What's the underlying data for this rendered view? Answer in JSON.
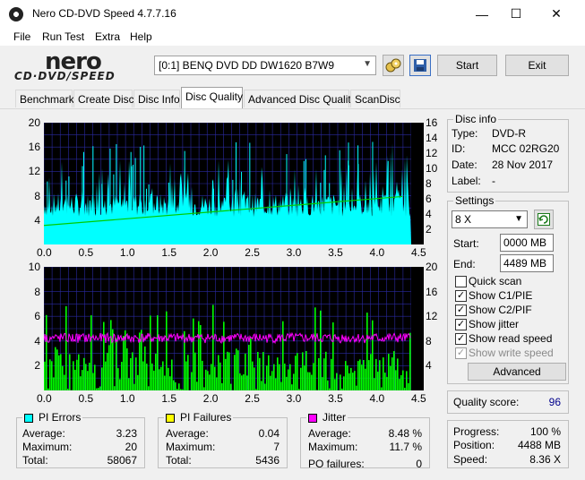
{
  "window": {
    "title": "Nero CD-DVD Speed 4.7.7.16",
    "minimize": "—",
    "maximize": "☐",
    "close": "✕"
  },
  "menu": [
    "File",
    "Run Test",
    "Extra",
    "Help"
  ],
  "logo": {
    "line1": "nero",
    "line2": "CD·DVD/SPEED"
  },
  "toolbar": {
    "drive": "[0:1]  BENQ DVD DD DW1620 B7W9",
    "start": "Start",
    "exit": "Exit",
    "icons": [
      "eject-swap-icon",
      "save-icon"
    ]
  },
  "tabs": [
    "Benchmark",
    "Create Disc",
    "Disc Info",
    "Disc Quality",
    "Advanced Disc Quality",
    "ScanDisc"
  ],
  "active_tab": "Disc Quality",
  "disc_info": {
    "title": "Disc info",
    "type_label": "Type:",
    "type": "DVD-R",
    "id_label": "ID:",
    "id": "MCC 02RG20",
    "date_label": "Date:",
    "date": "28 Nov 2017",
    "label_label": "Label:",
    "label": "-"
  },
  "settings": {
    "title": "Settings",
    "speed": "8 X",
    "start_label": "Start:",
    "start": "0000 MB",
    "end_label": "End:",
    "end": "4489 MB",
    "checks": [
      {
        "label": "Quick scan",
        "checked": false,
        "disabled": false
      },
      {
        "label": "Show C1/PIE",
        "checked": true,
        "disabled": false
      },
      {
        "label": "Show C2/PIF",
        "checked": true,
        "disabled": false
      },
      {
        "label": "Show jitter",
        "checked": true,
        "disabled": false
      },
      {
        "label": "Show read speed",
        "checked": true,
        "disabled": false
      },
      {
        "label": "Show write speed",
        "checked": true,
        "disabled": true
      }
    ],
    "advanced": "Advanced"
  },
  "quality": {
    "label": "Quality score:",
    "value": "96"
  },
  "progress": {
    "progress_label": "Progress:",
    "progress": "100 %",
    "position_label": "Position:",
    "position": "4488 MB",
    "speed_label": "Speed:",
    "speed": "8.36 X"
  },
  "pi_errors": {
    "title": "PI Errors",
    "color": "#00ffff",
    "avg_label": "Average:",
    "avg": "3.23",
    "max_label": "Maximum:",
    "max": "20",
    "total_label": "Total:",
    "total": "58067"
  },
  "pi_failures": {
    "title": "PI Failures",
    "color": "#ffff00",
    "avg_label": "Average:",
    "avg": "0.04",
    "max_label": "Maximum:",
    "max": "7",
    "total_label": "Total:",
    "total": "5436"
  },
  "jitter": {
    "title": "Jitter",
    "color": "#ff00ff",
    "avg_label": "Average:",
    "avg": "8.48 %",
    "max_label": "Maximum:",
    "max": "11.7 %",
    "po_label": "PO failures:",
    "po": "0"
  },
  "chart_data": [
    {
      "type": "bar",
      "x_ticks": [
        "0.0",
        "0.5",
        "1.0",
        "1.5",
        "2.0",
        "2.5",
        "3.0",
        "3.5",
        "4.0",
        "4.5"
      ],
      "y_left_ticks": [
        "20",
        "16",
        "12",
        "8",
        "4"
      ],
      "y_right_ticks": [
        "16",
        "14",
        "12",
        "10",
        "8",
        "6",
        "4",
        "2"
      ],
      "xlim": [
        0,
        4.5
      ],
      "ylim_left": [
        0,
        20
      ],
      "ylim_right": [
        0,
        16
      ],
      "series": [
        {
          "name": "PI Errors",
          "color": "#00ffff",
          "avg": 3.23,
          "max": 20
        },
        {
          "color": "#00cc00",
          "start": 2.5,
          "end": 6.3
        }
      ]
    },
    {
      "type": "bar",
      "x_ticks": [
        "0.0",
        "0.5",
        "1.0",
        "1.5",
        "2.0",
        "2.5",
        "3.0",
        "3.5",
        "4.0",
        "4.5"
      ],
      "y_left_ticks": [
        "10",
        "8",
        "6",
        "4",
        "2"
      ],
      "y_right_ticks": [
        "20",
        "16",
        "12",
        "8",
        "4"
      ],
      "xlim": [
        0,
        4.5
      ],
      "ylim_left": [
        0,
        10
      ],
      "ylim_right": [
        0,
        20
      ],
      "series": [
        {
          "name": "PI Failures",
          "color": "#00ff00",
          "max": 7
        },
        {
          "name": "Jitter",
          "color": "#ff00ff",
          "avg": 8.48
        }
      ]
    }
  ]
}
